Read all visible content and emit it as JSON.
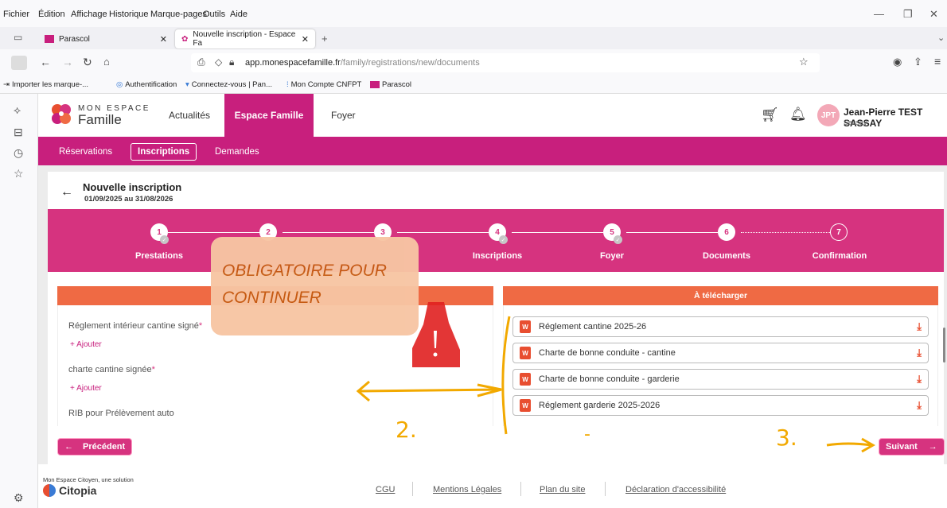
{
  "menu": [
    "Fichier",
    "Édition",
    "Affichage",
    "Historique",
    "Marque-pages",
    "Outils",
    "Aide"
  ],
  "tabs": [
    {
      "label": "Parascol",
      "active": false
    },
    {
      "label": "Nouvelle inscription - Espace Fa",
      "active": true
    }
  ],
  "url": {
    "domain": "app.monespacefamille.fr",
    "path": "/family/registrations/new/documents"
  },
  "bookmarks": [
    "Importer les marque-...",
    "Authentification",
    "Connectez-vous | Pan...",
    "Mon Compte CNFPT",
    "Parascol"
  ],
  "header": {
    "logo_top": "MON ESPACE",
    "logo_bottom": "Famille",
    "nav": [
      "Actualités",
      "Espace Famille",
      "Foyer"
    ],
    "user_initials": "JPT",
    "user_name": "Jean-Pierre TEST SASSAY",
    "user_sub": "Sassay"
  },
  "subnav": [
    "Réservations",
    "Inscriptions",
    "Demandes"
  ],
  "page": {
    "title": "Nouvelle inscription",
    "dates": "01/09/2025 au 31/08/2026"
  },
  "steps": [
    {
      "num": "1",
      "label": "Prestations"
    },
    {
      "num": "2",
      "label": ""
    },
    {
      "num": "3",
      "label": ""
    },
    {
      "num": "4",
      "label": "Inscriptions"
    },
    {
      "num": "5",
      "label": "Foyer"
    },
    {
      "num": "6",
      "label": "Documents"
    },
    {
      "num": "7",
      "label": "Confirmation"
    }
  ],
  "left_fields": [
    {
      "label": "Réglement intérieur cantine signé",
      "required": "*",
      "add": "+ Ajouter"
    },
    {
      "label": "charte cantine signée",
      "required": "*",
      "add": "+ Ajouter"
    },
    {
      "label": "RIB pour Prélèvement auto"
    }
  ],
  "download": {
    "title": "À télécharger",
    "files": [
      "Réglement cantine 2025-26",
      "Charte de bonne conduite - cantine",
      "Charte de bonne conduite - garderie",
      "Réglement garderie 2025-2026"
    ]
  },
  "buttons": {
    "prev": "Précédent",
    "next": "Suivant"
  },
  "annotation": {
    "note": "OBLIGATOIRE POUR CONTINUER",
    "mark2": "2.",
    "mark3": "3.",
    "dot": "-"
  },
  "footer": {
    "brand_line": "Mon Espace Citoyen, une solution",
    "brand": "Citopia",
    "links": [
      "CGU",
      "Mentions Légales",
      "Plan du site",
      "Déclaration d'accessibilité"
    ]
  },
  "colors": {
    "primary": "#c81f7d",
    "accent": "#ef6a44",
    "annotation": "#f2a900"
  }
}
